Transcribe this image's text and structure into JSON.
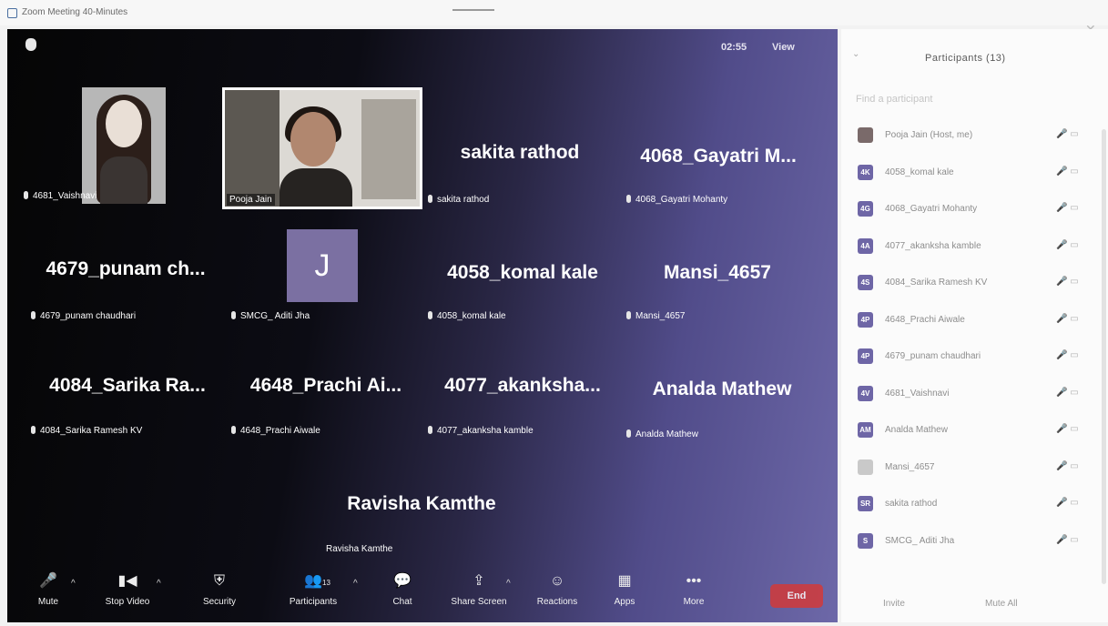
{
  "window": {
    "title": "Zoom Meeting 40-Minutes",
    "minimize": "—",
    "close": "✕"
  },
  "meeting": {
    "timer": "02:55",
    "view_label": "View"
  },
  "tiles": [
    {
      "display": "",
      "label": "4681_Vaishnavi",
      "has_video": true
    },
    {
      "display": "",
      "label": "Pooja Jain",
      "has_video": true
    },
    {
      "display": "sakita rathod",
      "label": "sakita rathod"
    },
    {
      "display": "4068_Gayatri M...",
      "label": "4068_Gayatri Mohanty"
    },
    {
      "display": "4679_punam ch...",
      "label": "4679_punam chaudhari"
    },
    {
      "display": "J",
      "label": "SMCG_ Aditi Jha"
    },
    {
      "display": "4058_komal kale",
      "label": "4058_komal kale"
    },
    {
      "display": "Mansi_4657",
      "label": "Mansi_4657"
    },
    {
      "display": "4084_Sarika Ra...",
      "label": "4084_Sarika Ramesh KV"
    },
    {
      "display": "4648_Prachi Ai...",
      "label": "4648_Prachi Aiwale"
    },
    {
      "display": "4077_akanksha...",
      "label": "4077_akanksha kamble"
    },
    {
      "display": "Analda Mathew",
      "label": "Analda Mathew"
    },
    {
      "display": "Ravisha Kamthe",
      "label": "Ravisha Kamthe"
    }
  ],
  "toolbar": {
    "mute": "Mute",
    "stop_video": "Stop Video",
    "security": "Security",
    "participants": "Participants",
    "participants_count": "13",
    "chat": "Chat",
    "share_screen": "Share Screen",
    "reactions": "Reactions",
    "apps": "Apps",
    "more": "More",
    "end": "End"
  },
  "panel": {
    "title": "Participants (13)",
    "search_placeholder": "Find a participant",
    "participants": [
      {
        "initials": "",
        "name": "Pooja Jain (Host, me)"
      },
      {
        "initials": "4K",
        "name": "4058_komal kale"
      },
      {
        "initials": "4G",
        "name": "4068_Gayatri Mohanty"
      },
      {
        "initials": "4A",
        "name": "4077_akanksha kamble"
      },
      {
        "initials": "4S",
        "name": "4084_Sarika Ramesh KV"
      },
      {
        "initials": "4P",
        "name": "4648_Prachi Aiwale"
      },
      {
        "initials": "4P",
        "name": "4679_punam chaudhari"
      },
      {
        "initials": "4V",
        "name": "4681_Vaishnavi"
      },
      {
        "initials": "AM",
        "name": "Analda Mathew"
      },
      {
        "initials": "",
        "name": "Mansi_4657"
      },
      {
        "initials": "SR",
        "name": "sakita rathod"
      },
      {
        "initials": "S",
        "name": "SMCG_ Aditi Jha"
      }
    ],
    "invite": "Invite",
    "mute_all": "Mute All"
  },
  "colors": {
    "video_bg": "#0c0c14",
    "tint": "#6d68a8",
    "avatar": "#7b70a2",
    "end_button": "#d23a3a"
  }
}
